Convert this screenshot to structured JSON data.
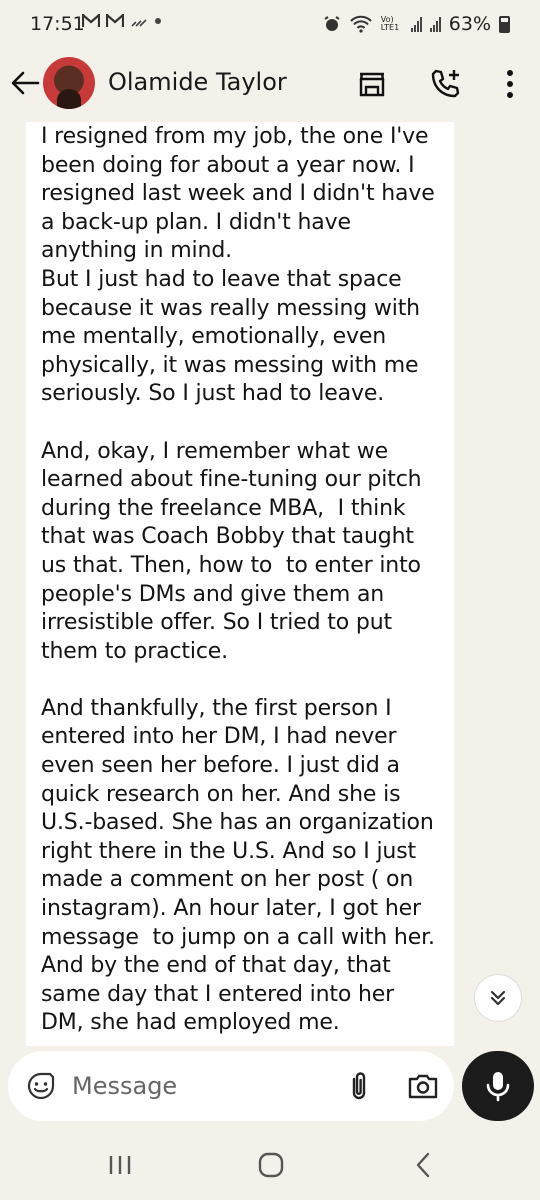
{
  "status_bar": {
    "time": "17:51",
    "notification_icons": [
      "gmail-icon",
      "gmail-icon",
      "wifi-calling-icon",
      "dot"
    ],
    "battery": "63%",
    "volte_label": "Vo) LTE1"
  },
  "header": {
    "contact_name": "Olamide Taylor"
  },
  "message": {
    "text": "I resigned from my job, the one I've been doing for about a year now. I resigned last week and I didn't have a back-up plan. I didn't have anything in mind.\nBut I just had to leave that space because it was really messing with me mentally, emotionally, even physically, it was messing with me seriously. So I just had to leave.\n\nAnd, okay, I remember what we learned about fine-tuning our pitch during the freelance MBA,  I think that was Coach Bobby that taught us that. Then, how to  to enter into people's DMs and give them an irresistible offer. So I tried to put them to practice.\n\nAnd thankfully, the first person I entered into her DM, I had never even seen her before. I just did a quick research on her. And she is U.S.-based. She has an organization right there in the U.S. And so I just made a comment on her post ( on instagram). An hour later, I got her message  to jump on a call with her. And by the end of that day, that same day that I entered into her DM, she had employed me."
  },
  "input": {
    "placeholder": "Message"
  },
  "colors": {
    "background": "#f4f1ea",
    "bubble": "#ffffff",
    "mic_button": "#1b1b1b"
  }
}
